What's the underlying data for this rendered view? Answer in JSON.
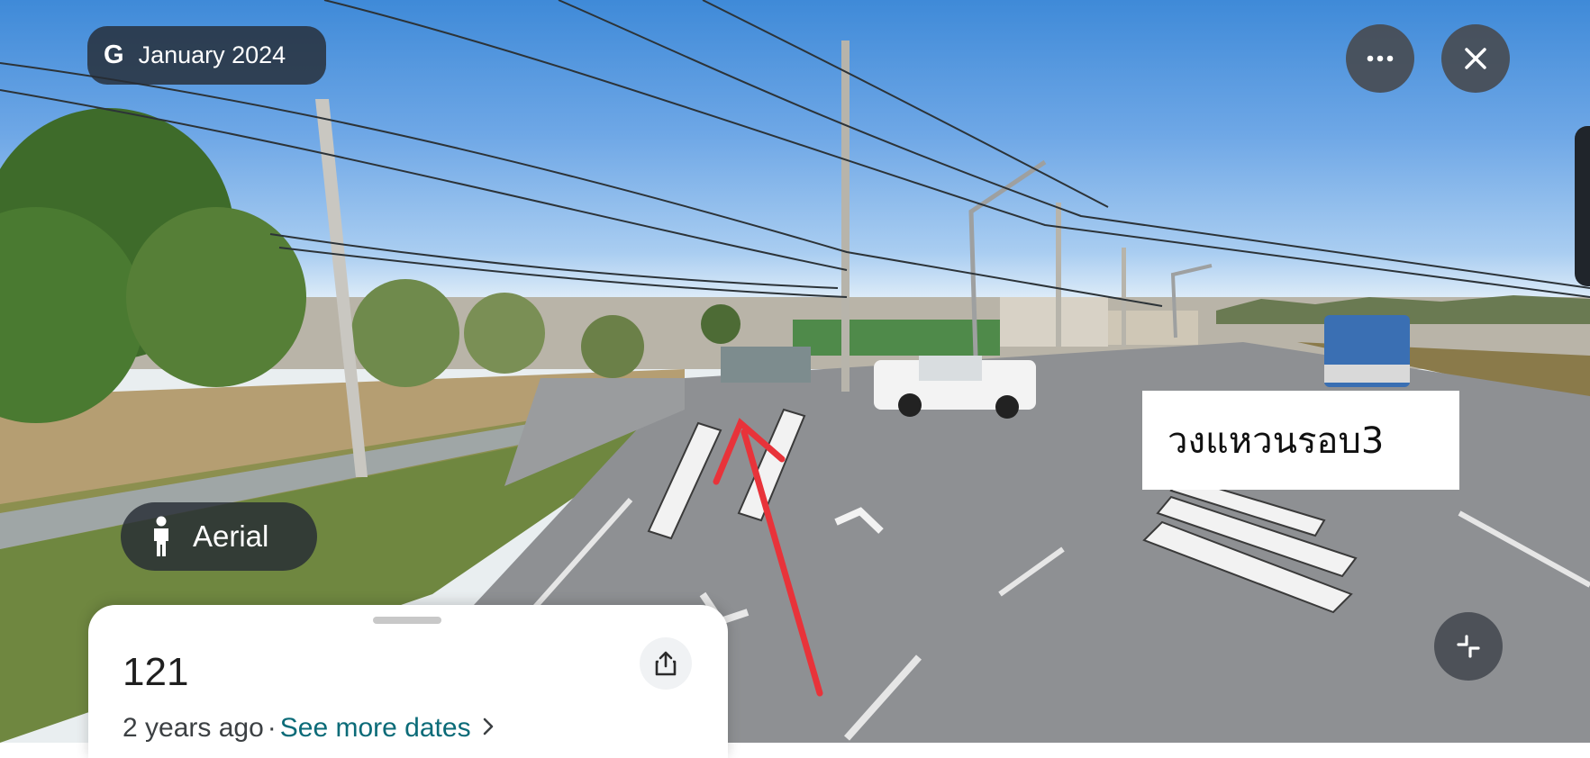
{
  "viewer": {
    "date_badge": {
      "logo": "G",
      "date": "January 2024"
    },
    "mode_toggle": {
      "icon": "person-icon",
      "label": "Aerial"
    },
    "controls": {
      "more_icon": "ellipsis-icon",
      "close_icon": "close-icon",
      "collapse_icon": "collapse-icon"
    },
    "overlay_label": "วงแหวนรอบ3"
  },
  "panel": {
    "title": "121",
    "age": "2 years ago",
    "separator": "·",
    "more_dates_link": "See more dates",
    "share_icon": "share-icon"
  },
  "colors": {
    "chip_bg": "#262c34",
    "link": "#0b6b78",
    "annotation_arrow": "#e8333a"
  }
}
